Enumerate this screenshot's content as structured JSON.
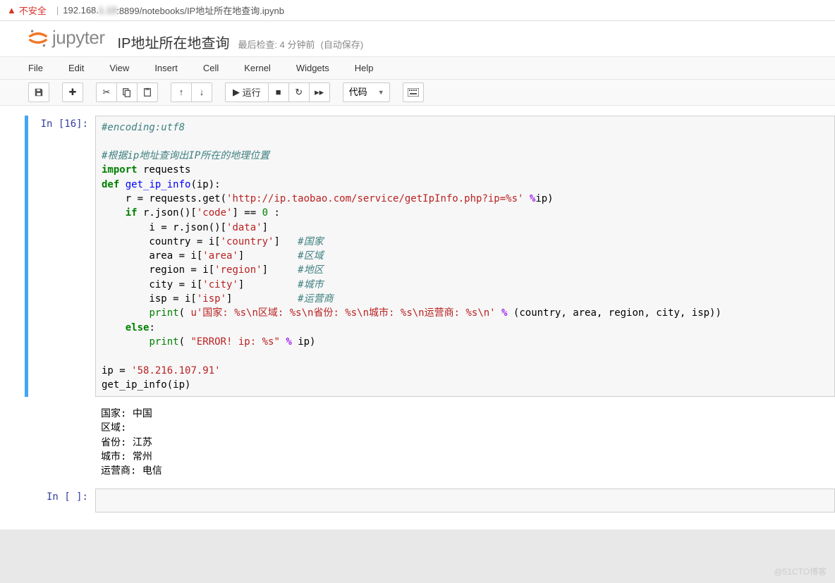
{
  "browser": {
    "insecure_label": "不安全",
    "url_prefix": "192.168.",
    "url_blurred": "1.13",
    "url_suffix": ":8899/notebooks/IP地址所在地查询.ipynb"
  },
  "header": {
    "logo_text": "jupyter",
    "nb_title": "IP地址所在地查询",
    "last_check": "最后检查: 4 分钟前",
    "autosave": "(自动保存)"
  },
  "menu": {
    "items": [
      "File",
      "Edit",
      "View",
      "Insert",
      "Cell",
      "Kernel",
      "Widgets",
      "Help"
    ]
  },
  "toolbar": {
    "run_label": "运行",
    "cell_type": "代码"
  },
  "cells": [
    {
      "prompt": "In [16]:",
      "code_tokens": [
        {
          "t": "#encoding:utf8",
          "c": "c-comment"
        },
        {
          "t": "\n\n"
        },
        {
          "t": "#根据ip地址查询出IP所在的地理位置",
          "c": "c-comment"
        },
        {
          "t": "\n"
        },
        {
          "t": "import",
          "c": "c-keyword"
        },
        {
          "t": " requests\n"
        },
        {
          "t": "def",
          "c": "c-keyword"
        },
        {
          "t": " "
        },
        {
          "t": "get_ip_info",
          "c": "c-def"
        },
        {
          "t": "(ip):\n"
        },
        {
          "t": "    r = requests.get("
        },
        {
          "t": "'http://ip.taobao.com/service/getIpInfo.php?ip=%s'",
          "c": "c-string"
        },
        {
          "t": " "
        },
        {
          "t": "%",
          "c": "c-op"
        },
        {
          "t": "ip)\n"
        },
        {
          "t": "    "
        },
        {
          "t": "if",
          "c": "c-keyword"
        },
        {
          "t": " r.json()["
        },
        {
          "t": "'code'",
          "c": "c-string"
        },
        {
          "t": "] == "
        },
        {
          "t": "0",
          "c": "c-num"
        },
        {
          "t": " :\n"
        },
        {
          "t": "        i = r.json()["
        },
        {
          "t": "'data'",
          "c": "c-string"
        },
        {
          "t": "]\n"
        },
        {
          "t": "        country = i["
        },
        {
          "t": "'country'",
          "c": "c-string"
        },
        {
          "t": "]   "
        },
        {
          "t": "#国家",
          "c": "c-comment"
        },
        {
          "t": "\n"
        },
        {
          "t": "        area = i["
        },
        {
          "t": "'area'",
          "c": "c-string"
        },
        {
          "t": "]         "
        },
        {
          "t": "#区域",
          "c": "c-comment"
        },
        {
          "t": "\n"
        },
        {
          "t": "        region = i["
        },
        {
          "t": "'region'",
          "c": "c-string"
        },
        {
          "t": "]     "
        },
        {
          "t": "#地区",
          "c": "c-comment"
        },
        {
          "t": "\n"
        },
        {
          "t": "        city = i["
        },
        {
          "t": "'city'",
          "c": "c-string"
        },
        {
          "t": "]         "
        },
        {
          "t": "#城市",
          "c": "c-comment"
        },
        {
          "t": "\n"
        },
        {
          "t": "        isp = i["
        },
        {
          "t": "'isp'",
          "c": "c-string"
        },
        {
          "t": "]           "
        },
        {
          "t": "#运营商",
          "c": "c-comment"
        },
        {
          "t": "\n"
        },
        {
          "t": "        "
        },
        {
          "t": "print",
          "c": "c-builtin"
        },
        {
          "t": "( "
        },
        {
          "t": "u'国家: %s\\n区域: %s\\n省份: %s\\n城市: %s\\n运营商: %s\\n'",
          "c": "c-string"
        },
        {
          "t": " "
        },
        {
          "t": "%",
          "c": "c-op"
        },
        {
          "t": " (country, area, region, city, isp))\n"
        },
        {
          "t": "    "
        },
        {
          "t": "else",
          "c": "c-keyword"
        },
        {
          "t": ":\n"
        },
        {
          "t": "        "
        },
        {
          "t": "print",
          "c": "c-builtin"
        },
        {
          "t": "( "
        },
        {
          "t": "\"ERROR! ip: %s\"",
          "c": "c-string"
        },
        {
          "t": " "
        },
        {
          "t": "%",
          "c": "c-op"
        },
        {
          "t": " ip)\n\n"
        },
        {
          "t": "ip = "
        },
        {
          "t": "'58.216.107.91'",
          "c": "c-string"
        },
        {
          "t": "\n"
        },
        {
          "t": "get_ip_info(ip)"
        }
      ],
      "output": "国家: 中国\n区域: \n省份: 江苏\n城市: 常州\n运营商: 电信"
    },
    {
      "prompt": "In [ ]:",
      "code_tokens": [
        {
          "t": " "
        }
      ],
      "output": null
    }
  ],
  "watermark": "@51CTO博客"
}
